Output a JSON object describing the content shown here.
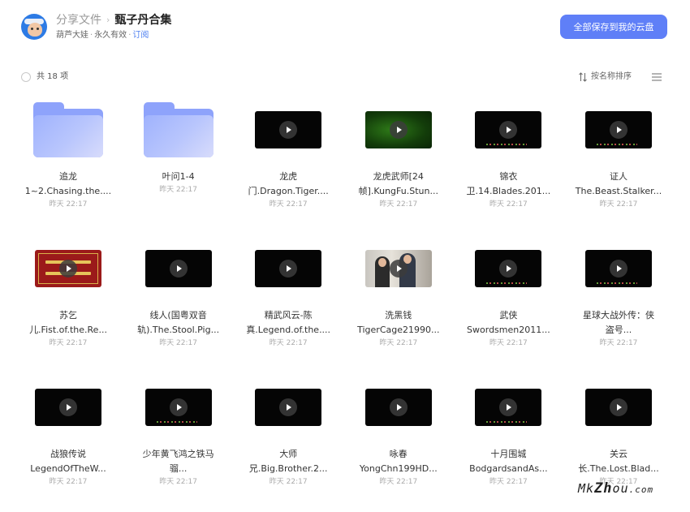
{
  "header": {
    "breadcrumb_parent": "分享文件",
    "breadcrumb_sep": "›",
    "title": "甄子丹合集",
    "owner": "葫芦大娃",
    "validity": "永久有效",
    "subscribe": "订阅",
    "dot": "·",
    "save_all_label": "全部保存到我的云盘"
  },
  "toolbar": {
    "count_label": "共 18 项",
    "sort_label": "按名称排序"
  },
  "icons": {
    "sort": "sort-arrows-icon",
    "view": "list-view-icon",
    "play": "play-icon",
    "folder": "folder-icon"
  },
  "colors": {
    "accent": "#5f7ff7",
    "link": "#4a7df0",
    "folder": "#8ea3fb"
  },
  "items": [
    {
      "type": "folder",
      "line1": "追龙",
      "line2": "1~2.Chasing.the....",
      "time": "昨天 22:17"
    },
    {
      "type": "folder",
      "line1": "叶问1-4",
      "line2": "",
      "time": "昨天 22:17"
    },
    {
      "type": "video",
      "thumb": "black",
      "line1": "龙虎",
      "line2": "门.Dragon.Tiger....",
      "time": "昨天 22:17"
    },
    {
      "type": "video",
      "thumb": "green",
      "line1": "龙虎武师[24",
      "line2": "帧].KungFu.Stun...",
      "time": "昨天 22:17"
    },
    {
      "type": "video",
      "thumb": "black-specks",
      "line1": "锦衣",
      "line2": "卫.14.Blades.201...",
      "time": "昨天 22:17"
    },
    {
      "type": "video",
      "thumb": "black-specks",
      "line1": "证人",
      "line2": "The.Beast.Stalker...",
      "time": "昨天 22:17"
    },
    {
      "type": "video",
      "thumb": "red",
      "line1": "苏乞",
      "line2": "儿.Fist.of.the.Re...",
      "time": "昨天 22:17"
    },
    {
      "type": "video",
      "thumb": "black",
      "line1": "线人(国粤双音",
      "line2": "轨).The.Stool.Pig...",
      "time": "昨天 22:17"
    },
    {
      "type": "video",
      "thumb": "black",
      "line1": "精武风云-陈",
      "line2": "真.Legend.of.the....",
      "time": "昨天 22:17"
    },
    {
      "type": "video",
      "thumb": "office",
      "line1": "洗黑钱",
      "line2": "TigerCage21990...",
      "time": "昨天 22:17"
    },
    {
      "type": "video",
      "thumb": "black-specks",
      "line1": "武侠",
      "line2": "Swordsmen2011...",
      "time": "昨天 22:17"
    },
    {
      "type": "video",
      "thumb": "black-specks",
      "line1": "星球大战外传：侠",
      "line2": "盗号...",
      "time": "昨天 22:17"
    },
    {
      "type": "video",
      "thumb": "black",
      "line1": "战狼传说",
      "line2": "LegendOfTheW...",
      "time": "昨天 22:17"
    },
    {
      "type": "video",
      "thumb": "black-specks",
      "line1": "少年黄飞鸿之铁马",
      "line2": "骝...",
      "time": "昨天 22:17"
    },
    {
      "type": "video",
      "thumb": "black",
      "line1": "大师",
      "line2": "兄.Big.Brother.2...",
      "time": "昨天 22:17"
    },
    {
      "type": "video",
      "thumb": "black",
      "line1": "咏春",
      "line2": "YongChn199HD...",
      "time": "昨天 22:17"
    },
    {
      "type": "video",
      "thumb": "black-specks",
      "line1": "十月围城",
      "line2": "BodgardsandAs...",
      "time": "昨天 22:17"
    },
    {
      "type": "video",
      "thumb": "black",
      "line1": "关云",
      "line2": "长.The.Lost.Blad...",
      "time": "昨天 22:17"
    }
  ],
  "watermark": {
    "text_a": "Mk",
    "text_b": "Zh",
    "text_c": "ou",
    "text_d": ".com"
  }
}
